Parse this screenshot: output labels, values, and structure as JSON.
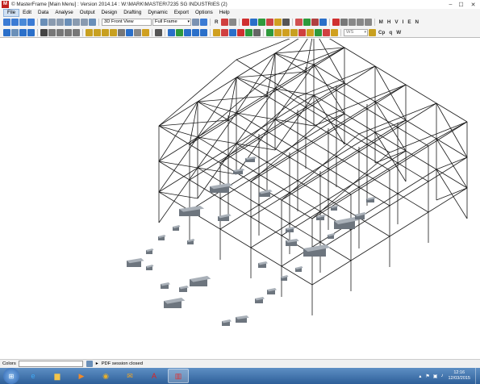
{
  "window": {
    "title": "© MasterFrame [Main Menu] : Version 2014.14 : W:\\MARK\\MASTER\\7235 SG INDUSTRIES (2)"
  },
  "menu": [
    "File",
    "Edit",
    "Data",
    "Analyse",
    "Output",
    "Design",
    "Drafting",
    "Dynamic",
    "Export",
    "Options",
    "Help"
  ],
  "toolbar1": {
    "view_combo": "3D Front View",
    "frame_combo": "Full Frame",
    "letters": [
      "M",
      "H",
      "V",
      "I",
      "E",
      "N"
    ]
  },
  "toolbar2": {
    "ws_combo": "WS",
    "letters": [
      "Cp",
      "q",
      "W"
    ]
  },
  "status": {
    "colors_label": "Colors",
    "message": "PDF session closed"
  },
  "tray": {
    "time": "12:16",
    "date": "12/03/2015"
  }
}
